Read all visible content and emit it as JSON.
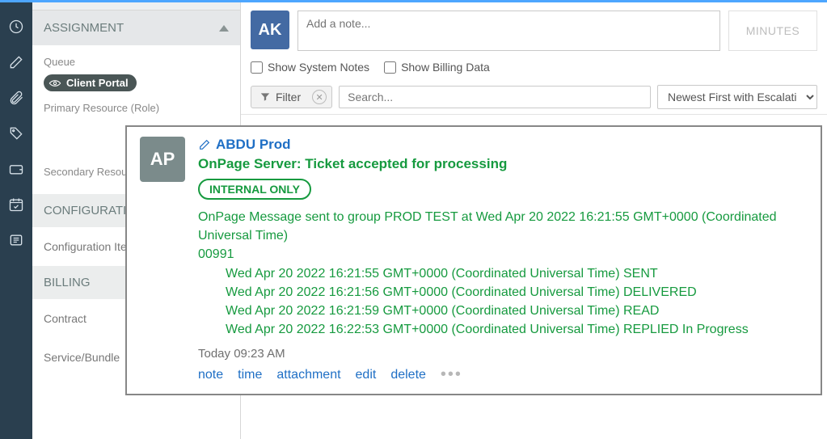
{
  "sidebar": {
    "sections": {
      "assignment": {
        "title": "ASSIGNMENT",
        "queue_label": "Queue",
        "queue_pill": "Client Portal",
        "primary_label": "Primary Resource (Role)",
        "secondary_label": "Secondary Resources"
      },
      "configurations": {
        "title": "CONFIGURATIONS",
        "link": "Configuration Items"
      },
      "billing": {
        "title": "BILLING",
        "contract": "Contract",
        "service": "Service/Bundle"
      }
    }
  },
  "notes_panel": {
    "avatar_initials": "AK",
    "note_placeholder": "Add a note...",
    "minutes_label": "MINUTES",
    "show_system_label": "Show System Notes",
    "show_billing_label": "Show Billing Data",
    "filter_label": "Filter",
    "search_placeholder": "Search...",
    "sort_label": "Newest First with Escalation"
  },
  "note": {
    "avatar_initials": "AP",
    "author": "ABDU Prod",
    "subject": "OnPage Server: Ticket accepted for processing",
    "badge": "INTERNAL ONLY",
    "body_line1": "OnPage Message sent to group PROD TEST at Wed Apr 20 2022 16:21:55 GMT+0000 (Coordinated Universal Time)",
    "body_line2": "00991",
    "events": [
      "Wed Apr 20 2022 16:21:55 GMT+0000 (Coordinated Universal Time) SENT",
      "Wed Apr 20 2022 16:21:56 GMT+0000 (Coordinated Universal Time) DELIVERED",
      "Wed Apr 20 2022 16:21:59 GMT+0000 (Coordinated Universal Time) READ",
      "Wed Apr 20 2022 16:22:53 GMT+0000 (Coordinated Universal Time) REPLIED In Progress"
    ],
    "timestamp": "Today 09:23 AM",
    "actions": {
      "note": "note",
      "time": "time",
      "attachment": "attachment",
      "edit": "edit",
      "delete": "delete"
    }
  }
}
